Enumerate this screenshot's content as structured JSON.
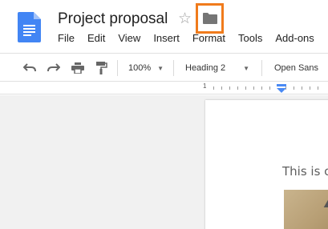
{
  "header": {
    "title": "Project proposal",
    "star_icon": "star-outline-icon",
    "folder_icon": "folder-icon",
    "highlight_color": "#f07b1c"
  },
  "menubar": {
    "items": [
      "File",
      "Edit",
      "View",
      "Insert",
      "Format",
      "Tools",
      "Add-ons"
    ]
  },
  "toolbar": {
    "undo_icon": "undo-icon",
    "redo_icon": "redo-icon",
    "print_icon": "print-icon",
    "paint_format_icon": "paint-format-icon",
    "zoom": "100%",
    "style": "Heading 2",
    "font": "Open Sans"
  },
  "ruler": {
    "label": "1"
  },
  "document": {
    "visible_text": "This is c"
  }
}
